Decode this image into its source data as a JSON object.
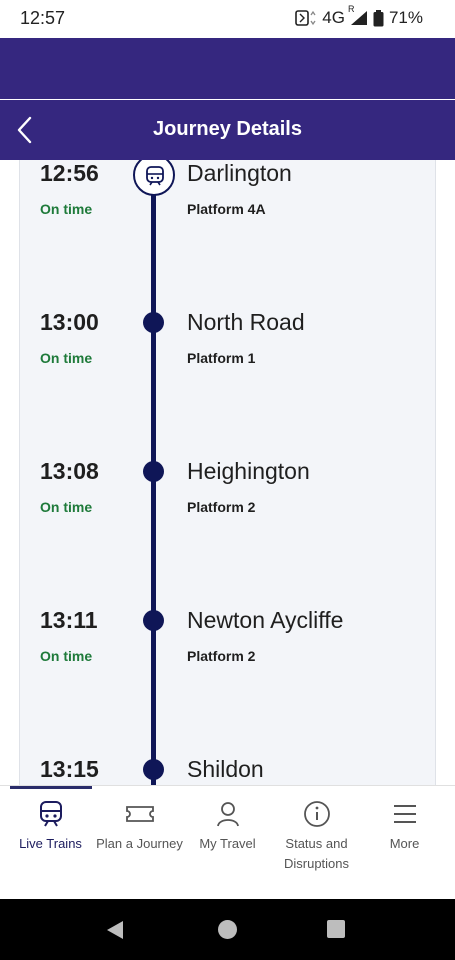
{
  "status_bar": {
    "time": "12:57",
    "network": "4G",
    "roaming": "R",
    "battery": "71%"
  },
  "header": {
    "title": "Journey Details",
    "color": "#35277f"
  },
  "stops": [
    {
      "time": "13:00",
      "status": "On time",
      "name": "North Road",
      "platform": "Platform 1"
    },
    {
      "time": "13:08",
      "status": "On time",
      "name": "Heighington",
      "platform": "Platform 2"
    },
    {
      "time": "13:11",
      "status": "On time",
      "name": "Newton Aycliffe",
      "platform": "Platform 2"
    },
    {
      "time": "13:15",
      "status": "",
      "name": "Shildon",
      "platform": ""
    }
  ],
  "current_stop": {
    "time": "12:56",
    "status": "On time",
    "name": "Darlington",
    "platform": "Platform 4A"
  },
  "nav": {
    "items": [
      {
        "label": "Live Trains",
        "icon": "train-icon",
        "active": true
      },
      {
        "label": "Plan a Journey",
        "icon": "ticket-icon",
        "active": false
      },
      {
        "label": "My Travel",
        "icon": "person-icon",
        "active": false
      },
      {
        "label": "Status and Disruptions",
        "icon": "info-icon",
        "active": false
      },
      {
        "label": "More",
        "icon": "menu-icon",
        "active": false
      }
    ]
  },
  "colors": {
    "on_time": "#1e7a3a",
    "timeline": "#0f1657",
    "accent": "#35277f"
  }
}
